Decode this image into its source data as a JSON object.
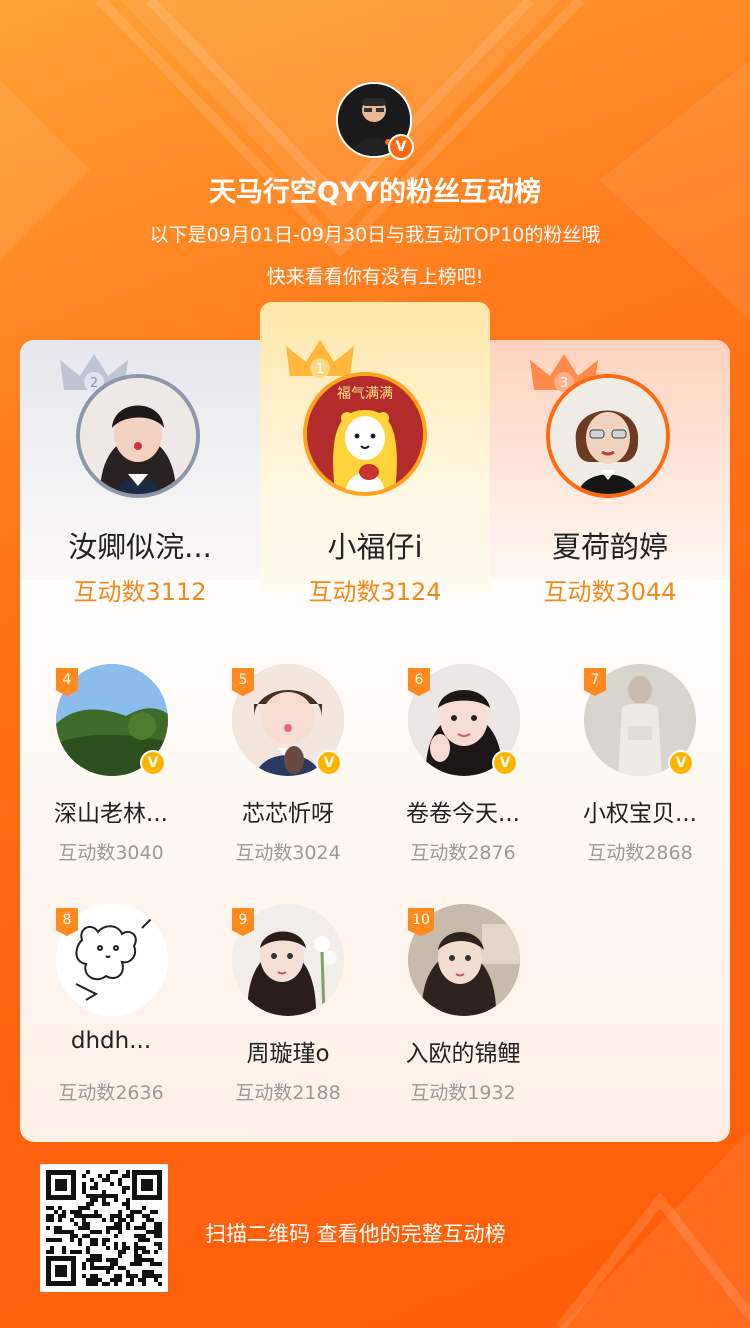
{
  "header": {
    "title": "天马行空QYY的粉丝互动榜",
    "subtitle": "以下是09月01日-09月30日与我互动TOP10的粉丝哦",
    "subtitle2": "快来看看你有没有上榜吧!",
    "verified_icon": "v-badge-icon"
  },
  "top3": [
    {
      "rank": "1",
      "name": "小福仔i",
      "count": "互动数3124",
      "avatar_text": "福气满满",
      "crown_color": "#ffb63a"
    },
    {
      "rank": "2",
      "name": "汝卿似浣...",
      "count": "互动数3112",
      "crown_color": "#c0c6d4"
    },
    {
      "rank": "3",
      "name": "夏荷韵婷",
      "count": "互动数3044",
      "crown_color": "#ff8a4a"
    }
  ],
  "ranks": [
    {
      "rank": "4",
      "name": "深山老林...",
      "count": "互动数3040",
      "verified": true
    },
    {
      "rank": "5",
      "name": "芯芯忻呀",
      "count": "互动数3024",
      "verified": true
    },
    {
      "rank": "6",
      "name": "卷卷今天...",
      "count": "互动数2876",
      "verified": true
    },
    {
      "rank": "7",
      "name": "小权宝贝...",
      "count": "互动数2868",
      "verified": true
    },
    {
      "rank": "8",
      "name": "dhdh...",
      "count": "互动数2636",
      "verified": false
    },
    {
      "rank": "9",
      "name": "周璇瑾o",
      "count": "互动数2188",
      "verified": false
    },
    {
      "rank": "10",
      "name": "入欧的锦鲤",
      "count": "互动数1932",
      "verified": false
    }
  ],
  "footer": {
    "text": "扫描二维码 查看他的完整互动榜",
    "qr_icon": "qr-code-icon"
  },
  "colors": {
    "accent_orange": "#ff6410",
    "count_orange": "#f08a1a",
    "rank_tag": "#ff8a1e",
    "verified_yellow": "#ffb400"
  }
}
